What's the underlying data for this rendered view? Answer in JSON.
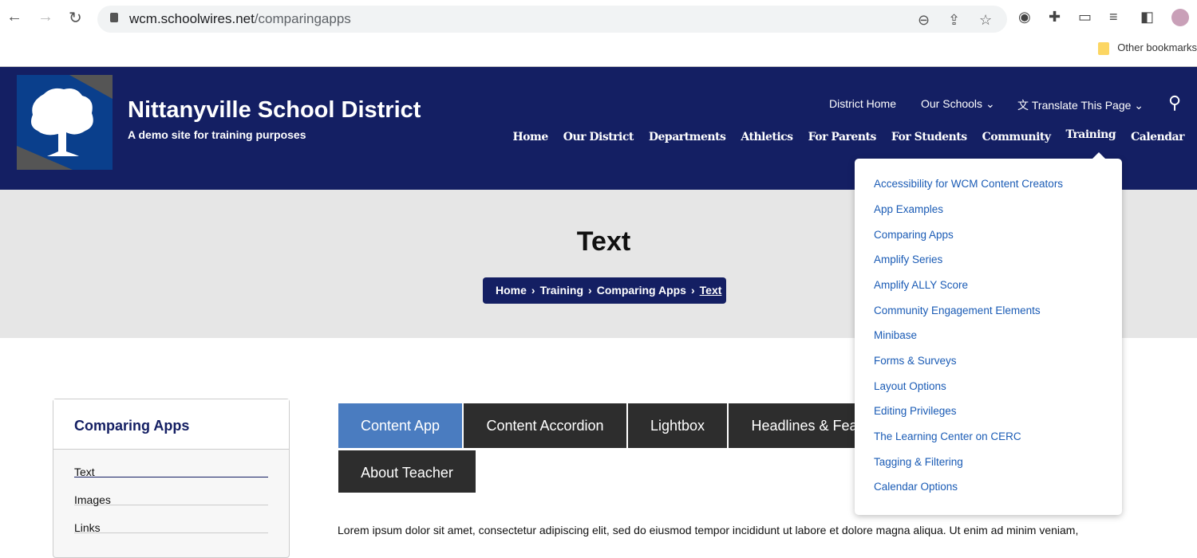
{
  "browser": {
    "url_host": "wcm.schoolwires.net",
    "url_path": "/comparingapps",
    "bookmarks_label": "Other bookmarks"
  },
  "site": {
    "title": "Nittanyville School District",
    "subtitle": "A demo site for training purposes"
  },
  "utility_nav": {
    "district_home": "District Home",
    "our_schools": "Our Schools",
    "translate": "Translate This Page"
  },
  "main_nav": [
    "Home",
    "Our District",
    "Departments",
    "Athletics",
    "For Parents",
    "For Students",
    "Community",
    "Training",
    "Calendar"
  ],
  "hero": {
    "title": "Text",
    "breadcrumb": [
      "Home",
      "Training",
      "Comparing Apps",
      "Text"
    ]
  },
  "sidebar": {
    "title": "Comparing Apps",
    "items": [
      "Text",
      "Images",
      "Links"
    ]
  },
  "tabs": [
    "Content App",
    "Content Accordion",
    "Lightbox",
    "Headlines & Features",
    "About Teacher"
  ],
  "body_text": "Lorem ipsum dolor sit amet, consectetur adipiscing elit, sed do eiusmod tempor incididunt ut labore et dolore magna aliqua. Ut enim ad minim veniam,",
  "training_menu": [
    "Accessibility for WCM Content Creators",
    "App Examples",
    "Comparing Apps",
    "Amplify Series",
    "Amplify ALLY Score",
    "Community Engagement Elements",
    "Minibase",
    "Forms & Surveys",
    "Layout Options",
    "Editing Privileges",
    "The Learning Center on CERC",
    "Tagging & Filtering",
    "Calendar Options"
  ],
  "colors": {
    "header": "#141f63",
    "active_tab": "#4a7cc0",
    "tab": "#2d2d2d",
    "menu_link": "#1a5bb5"
  }
}
